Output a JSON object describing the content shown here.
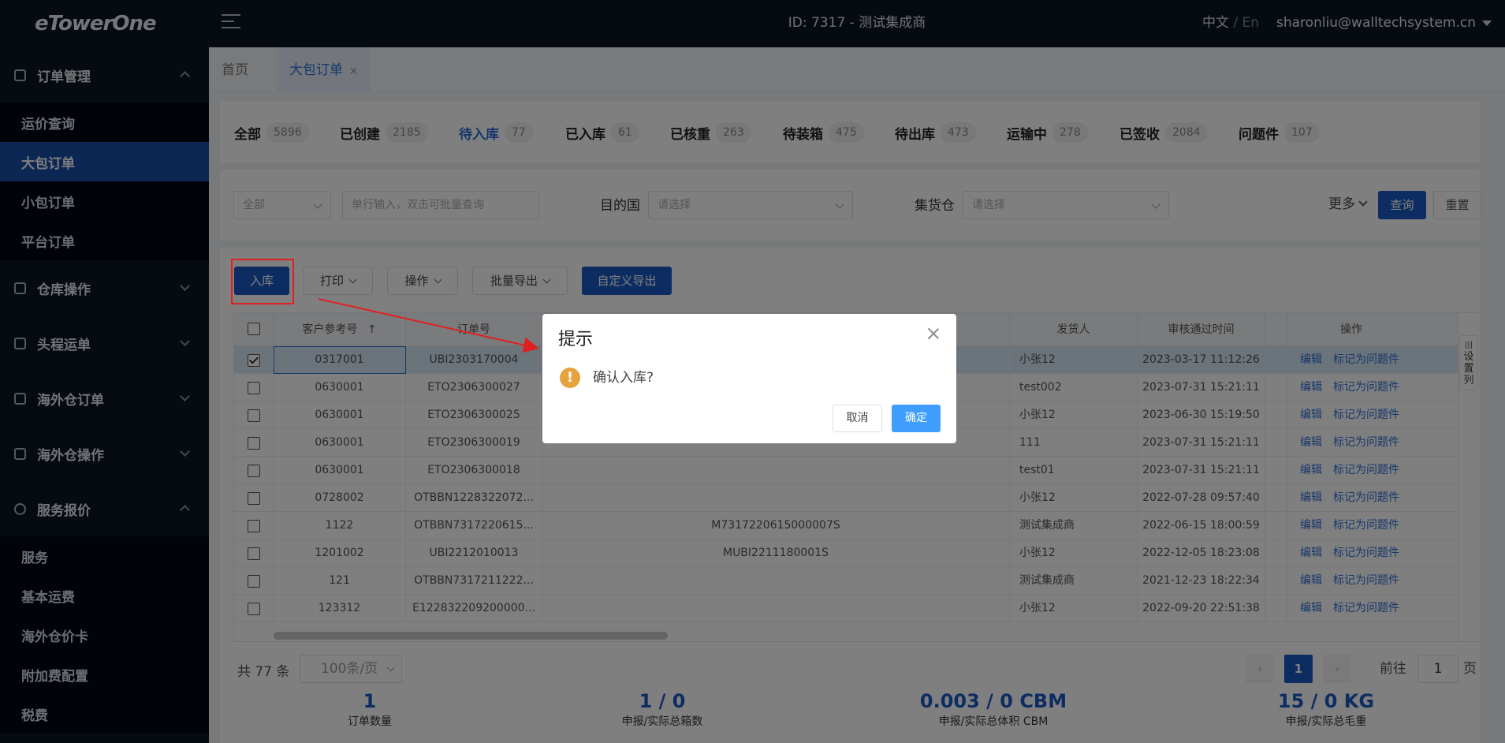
{
  "app": {
    "logo": "eTowerOne",
    "header_title": "ID: 7317 - 测试集成商",
    "lang_zh": "中文",
    "lang_sep": " / ",
    "lang_en": "En",
    "user": "sharonliu@walltechsystem.cn"
  },
  "sidebar": {
    "groups": [
      {
        "label": "订单管理",
        "icon": "order-icon",
        "expanded": true,
        "items": [
          "运价查询",
          "大包订单",
          "小包订单",
          "平台订单"
        ],
        "active": "大包订单"
      },
      {
        "label": "仓库操作",
        "icon": "warehouse-icon",
        "expanded": false
      },
      {
        "label": "头程运单",
        "icon": "lock-icon",
        "expanded": false
      },
      {
        "label": "海外仓订单",
        "icon": "receipt-icon",
        "expanded": false
      },
      {
        "label": "海外仓操作",
        "icon": "home-icon",
        "expanded": false
      },
      {
        "label": "服务报价",
        "icon": "network-icon",
        "expanded": true,
        "items": [
          "服务",
          "基本运费",
          "海外仓价卡",
          "附加费配置",
          "税费"
        ]
      }
    ]
  },
  "tabs": [
    {
      "label": "首页"
    },
    {
      "label": "大包订单",
      "close": "×",
      "active": true
    }
  ],
  "status_tabs": [
    {
      "label": "全部",
      "count": "5896"
    },
    {
      "label": "已创建",
      "count": "2185"
    },
    {
      "label": "待入库",
      "count": "77",
      "active": true
    },
    {
      "label": "已入库",
      "count": "61"
    },
    {
      "label": "已核重",
      "count": "263"
    },
    {
      "label": "待装箱",
      "count": "475"
    },
    {
      "label": "待出库",
      "count": "473"
    },
    {
      "label": "运输中",
      "count": "278"
    },
    {
      "label": "已签收",
      "count": "2084"
    },
    {
      "label": "问题件",
      "count": "107"
    }
  ],
  "filters": {
    "type_select": "全部",
    "search_placeholder": "单行输入，双击可批量查询",
    "dest_label": "目的国",
    "dest_placeholder": "请选择",
    "warehouse_label": "集货仓",
    "warehouse_placeholder": "请选择",
    "more": "更多",
    "query": "查询",
    "reset": "重置"
  },
  "actions": {
    "inbound": "入库",
    "print": "打印",
    "operate": "操作",
    "batch_export": "批量导出",
    "custom_export": "自定义导出"
  },
  "table": {
    "headers": {
      "ref": "客户参考号",
      "sort": "↑",
      "order_no": "订单号",
      "shipper": "发货人",
      "audit_time": "审核通过时间",
      "ops": "操作"
    },
    "settings_label": "设置列",
    "rows": [
      {
        "ref": "0317001",
        "order": "UBI2303170004",
        "mid": "",
        "shipper": "小张12",
        "time": "2023-03-17 11:12:26",
        "selected": true
      },
      {
        "ref": "0630001",
        "order": "ETO2306300027",
        "mid": "",
        "shipper": "test002",
        "time": "2023-07-31 15:21:11"
      },
      {
        "ref": "0630001",
        "order": "ETO2306300025",
        "mid": "",
        "shipper": "小张12",
        "time": "2023-06-30 15:19:50"
      },
      {
        "ref": "0630001",
        "order": "ETO2306300019",
        "mid": "",
        "shipper": "111",
        "time": "2023-07-31 15:21:11"
      },
      {
        "ref": "0630001",
        "order": "ETO2306300018",
        "mid": "",
        "shipper": "test01",
        "time": "2023-07-31 15:21:11"
      },
      {
        "ref": "0728002",
        "order": "OTBBN1228322072...",
        "mid": "",
        "shipper": "小张12",
        "time": "2022-07-28 09:57:40"
      },
      {
        "ref": "1122",
        "order": "OTBBN7317220615...",
        "mid": "M7317220615000007S",
        "shipper": "测试集成商",
        "time": "2022-06-15 18:00:59"
      },
      {
        "ref": "1201002",
        "order": "UBI2212010013",
        "mid": "MUBI2211180001S",
        "shipper": "小张12",
        "time": "2022-12-05 18:23:08"
      },
      {
        "ref": "121",
        "order": "OTBBN7317211222...",
        "mid": "",
        "shipper": "测试集成商",
        "time": "2021-12-23 18:22:34"
      },
      {
        "ref": "123312",
        "order": "E122832209200000...",
        "mid": "",
        "shipper": "小张12",
        "time": "2022-09-20 22:51:38"
      }
    ],
    "edit": "编辑",
    "mark_problem": "标记为问题件"
  },
  "pager": {
    "total": "共 77 条",
    "page_size": "100条/页",
    "prev": "‹",
    "current": "1",
    "next": "›",
    "goto_prefix": "前往",
    "goto_value": "1",
    "goto_suffix": "页"
  },
  "stats": [
    {
      "value": "1",
      "label": "订单数量"
    },
    {
      "value": "1 / 0",
      "label": "申报/实际总箱数"
    },
    {
      "value": "0.003 / 0 CBM",
      "label": "申报/实际总体积 CBM"
    },
    {
      "value": "15 / 0 KG",
      "label": "申报/实际总毛重"
    }
  ],
  "dialog": {
    "title": "提示",
    "icon": "!",
    "message": "确认入库?",
    "cancel": "取消",
    "confirm": "确定"
  },
  "colors": {
    "sidebar_bg": "#0c1624",
    "accent": "#1a5bc4",
    "active_tab_text": "#2d6fd6",
    "warning": "#e6a23c",
    "annotation_red": "#e02020"
  }
}
